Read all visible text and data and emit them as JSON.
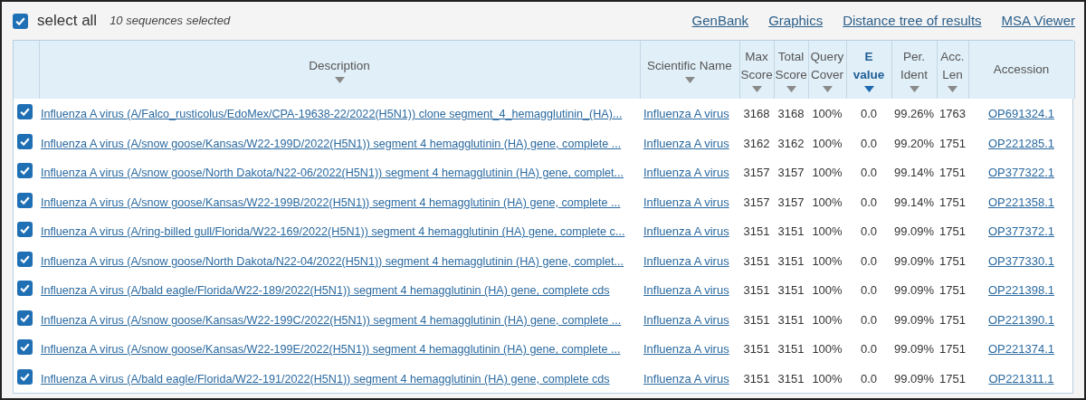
{
  "toolbar": {
    "select_all": {
      "label": "select all",
      "checked": true
    },
    "selection_count": "10 sequences selected",
    "links": [
      "GenBank",
      "Graphics",
      "Distance tree of results",
      "MSA Viewer"
    ]
  },
  "table": {
    "columns": [
      {
        "label": "Description",
        "sorted": false
      },
      {
        "label": "Scientific Name",
        "sorted": false
      },
      {
        "label": "Max Score",
        "sorted": false
      },
      {
        "label": "Total Score",
        "sorted": false
      },
      {
        "label": "Query Cover",
        "sorted": false
      },
      {
        "label": "E value",
        "sorted": true
      },
      {
        "label": "Per. Ident",
        "sorted": false
      },
      {
        "label": "Acc. Len",
        "sorted": false
      },
      {
        "label": "Accession"
      }
    ],
    "rows": [
      {
        "checked": true,
        "cells": [
          "Influenza A virus (A/Falco_rusticolus/EdoMex/CPA-19638-22/2022(H5N1)) clone segment_4_hemagglutinin_(HA)...",
          "Influenza A virus",
          "3168",
          "3168",
          "100%",
          "0.0",
          "99.26%",
          "1763",
          "OP691324.1"
        ]
      },
      {
        "checked": true,
        "cells": [
          "Influenza A virus (A/snow goose/Kansas/W22-199D/2022(H5N1)) segment 4 hemagglutinin (HA) gene, complete ...",
          "Influenza A virus",
          "3162",
          "3162",
          "100%",
          "0.0",
          "99.20%",
          "1751",
          "OP221285.1"
        ]
      },
      {
        "checked": true,
        "cells": [
          "Influenza A virus (A/snow goose/North Dakota/N22-06/2022(H5N1)) segment 4 hemagglutinin (HA) gene, complet...",
          "Influenza A virus",
          "3157",
          "3157",
          "100%",
          "0.0",
          "99.14%",
          "1751",
          "OP377322.1"
        ]
      },
      {
        "checked": true,
        "cells": [
          "Influenza A virus (A/snow goose/Kansas/W22-199B/2022(H5N1)) segment 4 hemagglutinin (HA) gene, complete ...",
          "Influenza A virus",
          "3157",
          "3157",
          "100%",
          "0.0",
          "99.14%",
          "1751",
          "OP221358.1"
        ]
      },
      {
        "checked": true,
        "cells": [
          "Influenza A virus (A/ring-billed gull/Florida/W22-169/2022(H5N1)) segment 4 hemagglutinin (HA) gene, complete c...",
          "Influenza A virus",
          "3151",
          "3151",
          "100%",
          "0.0",
          "99.09%",
          "1751",
          "OP377372.1"
        ]
      },
      {
        "checked": true,
        "cells": [
          "Influenza A virus (A/snow goose/North Dakota/N22-04/2022(H5N1)) segment 4 hemagglutinin (HA) gene, complet...",
          "Influenza A virus",
          "3151",
          "3151",
          "100%",
          "0.0",
          "99.09%",
          "1751",
          "OP377330.1"
        ]
      },
      {
        "checked": true,
        "cells": [
          "Influenza A virus (A/bald eagle/Florida/W22-189/2022(H5N1)) segment 4 hemagglutinin (HA) gene, complete cds",
          "Influenza A virus",
          "3151",
          "3151",
          "100%",
          "0.0",
          "99.09%",
          "1751",
          "OP221398.1"
        ]
      },
      {
        "checked": true,
        "cells": [
          "Influenza A virus (A/snow goose/Kansas/W22-199C/2022(H5N1)) segment 4 hemagglutinin (HA) gene, complete ...",
          "Influenza A virus",
          "3151",
          "3151",
          "100%",
          "0.0",
          "99.09%",
          "1751",
          "OP221390.1"
        ]
      },
      {
        "checked": true,
        "cells": [
          "Influenza A virus (A/snow goose/Kansas/W22-199E/2022(H5N1)) segment 4 hemagglutinin (HA) gene, complete ...",
          "Influenza A virus",
          "3151",
          "3151",
          "100%",
          "0.0",
          "99.09%",
          "1751",
          "OP221374.1"
        ]
      },
      {
        "checked": true,
        "cells": [
          "Influenza A virus (A/bald eagle/Florida/W22-191/2022(H5N1)) segment 4 hemagglutinin (HA) gene, complete cds",
          "Influenza A virus",
          "3151",
          "3151",
          "100%",
          "0.0",
          "99.09%",
          "1751",
          "OP221311.1"
        ]
      }
    ]
  }
}
